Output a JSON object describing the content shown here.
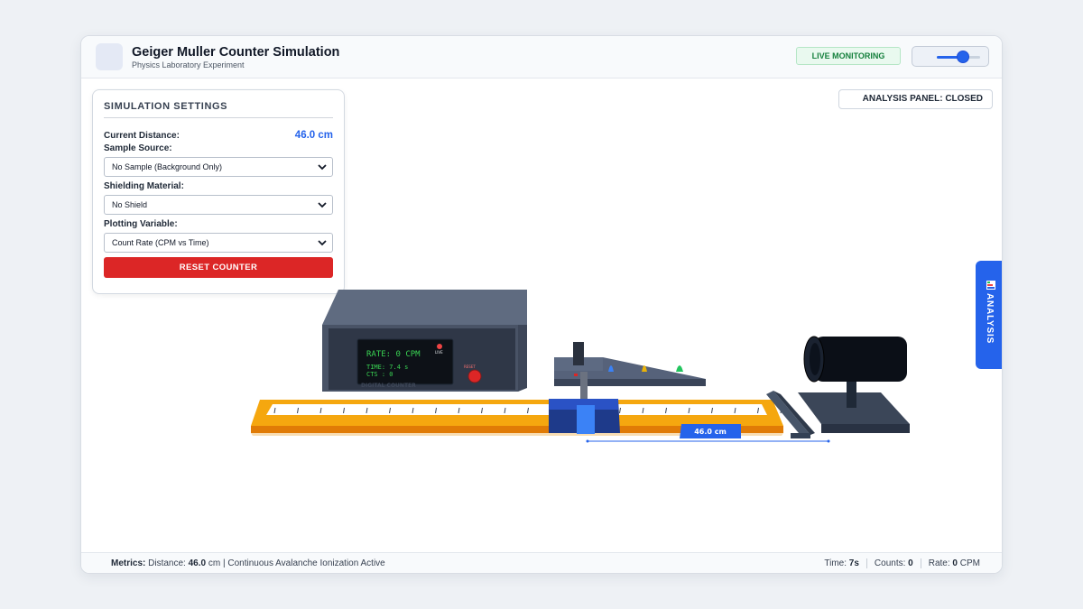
{
  "header": {
    "title": "Geiger Muller Counter Simulation",
    "subtitle": "Physics Laboratory Experiment",
    "live_badge": "LIVE MONITORING",
    "slider_level": 0.6
  },
  "settings": {
    "title": "SIMULATION SETTINGS",
    "distance_label": "Current Distance:",
    "distance_value": "46.0 cm",
    "source_label": "Sample Source:",
    "source_value": "No Sample (Background Only)",
    "shield_label": "Shielding Material:",
    "shield_value": "No Shield",
    "plot_label": "Plotting Variable:",
    "plot_value": "Count Rate (CPM vs Time)",
    "reset_label": "RESET COUNTER"
  },
  "analysis": {
    "status_label": "ANALYSIS PANEL: CLOSED",
    "tab_label": "ANALYSIS"
  },
  "device": {
    "rate_text": "RATE: 0 CPM",
    "time_text": "TIME: 7.4 s",
    "counts_text": "CTS : 0",
    "brand_text": "DIGITAL COUNTER",
    "live_led": "LIVE",
    "reset_led": "RESET"
  },
  "scene": {
    "distance_tag": "46.0 cm"
  },
  "colors": {
    "accent": "#2563eb",
    "danger": "#dc2626",
    "live": "#15803d",
    "ruler": "#f5a623",
    "screen_text": "#39d353"
  },
  "footer": {
    "metrics_label": "Metrics:",
    "distance_label": "Distance:",
    "distance_value": "46.0",
    "distance_unit": "cm",
    "status_text": "| Continuous Avalanche Ionization Active",
    "time_label": "Time:",
    "time_value": "7s",
    "counts_label": "Counts:",
    "counts_value": "0",
    "rate_label": "Rate:",
    "rate_value": "0",
    "rate_unit": "CPM"
  }
}
